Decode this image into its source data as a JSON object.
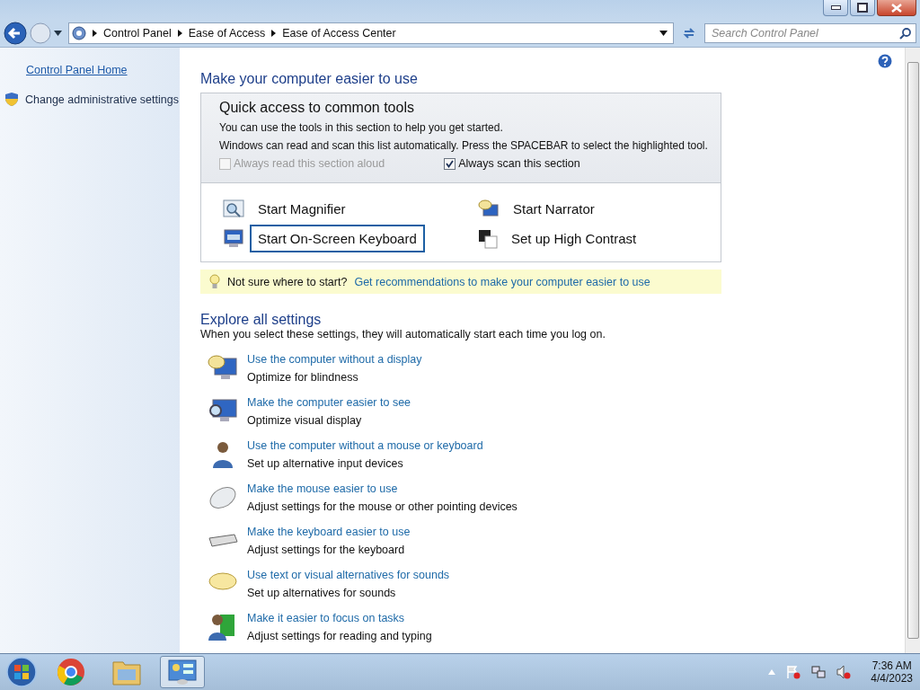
{
  "address_bar": {
    "breadcrumbs": [
      "Control Panel",
      "Ease of Access",
      "Ease of Access Center"
    ]
  },
  "search": {
    "placeholder": "Search Control Panel"
  },
  "sidebar": {
    "links": [
      {
        "label": "Control Panel Home",
        "kind": "link"
      },
      {
        "label": "Change administrative settings",
        "kind": "shield"
      }
    ]
  },
  "main": {
    "title": "Make your computer easier to use",
    "quick_access": {
      "title": "Quick access to common tools",
      "lines": [
        "You can use the tools in this section to help you get started.",
        "Windows can read and scan this list automatically.  Press the SPACEBAR to select the highlighted tool."
      ],
      "checkboxes": [
        {
          "label": "Always read this section aloud",
          "checked": false,
          "disabled": true
        },
        {
          "label": "Always scan this section",
          "checked": true,
          "disabled": false
        }
      ],
      "tools": [
        {
          "label": "Start Magnifier",
          "kind": "magnifier",
          "selected": false
        },
        {
          "label": "Start Narrator",
          "kind": "narrator",
          "selected": false
        },
        {
          "label": "Start On-Screen Keyboard",
          "kind": "keyboard",
          "selected": true
        },
        {
          "label": "Set up High Contrast",
          "kind": "contrast",
          "selected": false
        }
      ]
    },
    "tip": {
      "text": "Not sure where to start?",
      "link": "Get recommendations to make your computer easier to use"
    },
    "explore": {
      "title": "Explore all settings",
      "subtitle": "When you select these settings, they will automatically start each time you log on.",
      "items": [
        {
          "link": "Use the computer without a display",
          "description": "Optimize for blindness",
          "kind": "display"
        },
        {
          "link": "Make the computer easier to see",
          "description": "Optimize visual display",
          "kind": "see"
        },
        {
          "link": "Use the computer without a mouse or keyboard",
          "description": "Set up alternative input devices",
          "kind": "person"
        },
        {
          "link": "Make the mouse easier to use",
          "description": "Adjust settings for the mouse or other pointing devices",
          "kind": "mouse"
        },
        {
          "link": "Make the keyboard easier to use",
          "description": "Adjust settings for the keyboard",
          "kind": "keyboard"
        },
        {
          "link": "Use text or visual alternatives for sounds",
          "description": "Set up alternatives for sounds",
          "kind": "bubble"
        },
        {
          "link": "Make it easier to focus on tasks",
          "description": "Adjust settings for reading and typing",
          "kind": "focus"
        }
      ]
    }
  },
  "taskbar": {
    "apps": [
      {
        "kind": "chrome",
        "selected": false
      },
      {
        "kind": "explorer",
        "selected": false
      },
      {
        "kind": "control",
        "selected": true
      }
    ],
    "clock": {
      "time": "7:36 AM",
      "date": "4/4/2023"
    }
  }
}
